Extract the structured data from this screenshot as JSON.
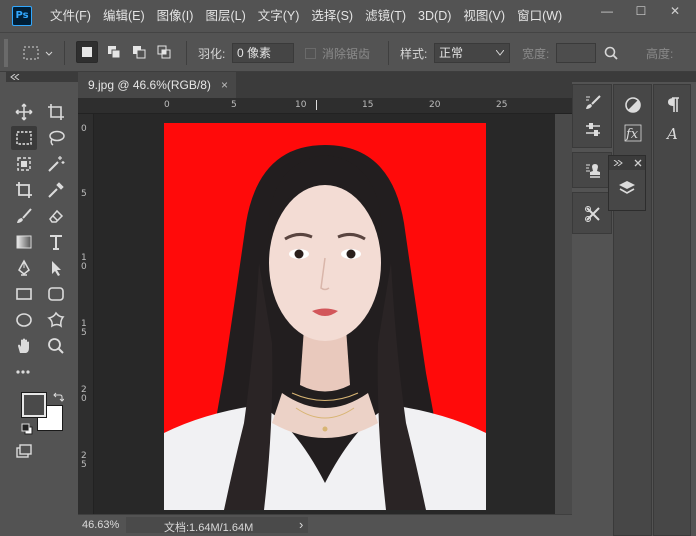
{
  "app": {
    "logo": "Ps",
    "menu": [
      "文件(F)",
      "编辑(E)",
      "图像(I)",
      "图层(L)",
      "文字(Y)",
      "选择(S)",
      "滤镜(T)",
      "3D(D)",
      "视图(V)",
      "窗口(W)"
    ],
    "window_controls": {
      "minimize": "—",
      "restore": "☐",
      "close": "✕"
    }
  },
  "options": {
    "feather_label": "羽化:",
    "feather_value": "0 像素",
    "antialias_label": "消除锯齿",
    "style_label": "样式:",
    "style_value": "正常",
    "width_label": "宽度:",
    "height_label": "高度:"
  },
  "document": {
    "tab_title": "9.jpg @ 46.6%(RGB/8)",
    "tab_close": "×",
    "ruler_h_labels": [
      "0",
      "5",
      "10",
      "15",
      "20",
      "25"
    ],
    "ruler_v_labels": [
      "0",
      "5",
      "1 0",
      "1 5",
      "2 0",
      "2 5"
    ],
    "image_bg_color": "#ff0a0a",
    "status_zoom": "46.63%",
    "status_doc": "文档:1.64M/1.64M",
    "status_arrow": "›"
  },
  "tools": [
    "move-icon",
    "artboard-icon",
    "marquee-icon",
    "lasso-icon",
    "object-select-icon",
    "magic-wand-icon",
    "crop-icon",
    "eyedropper-icon",
    "brush-icon",
    "eraser-icon",
    "gradient-icon",
    "type-icon",
    "pen-icon",
    "path-select-icon",
    "rectangle-icon",
    "rounded-rect-icon",
    "ellipse-icon",
    "shape-icon",
    "hand-icon",
    "zoom-icon",
    "more-tools-icon"
  ],
  "colors": {
    "foreground": "#4a4a4a",
    "background": "#ffffff",
    "accent": "#31a8ff"
  },
  "panels": {
    "layers_popup_label": "layers-icon"
  }
}
